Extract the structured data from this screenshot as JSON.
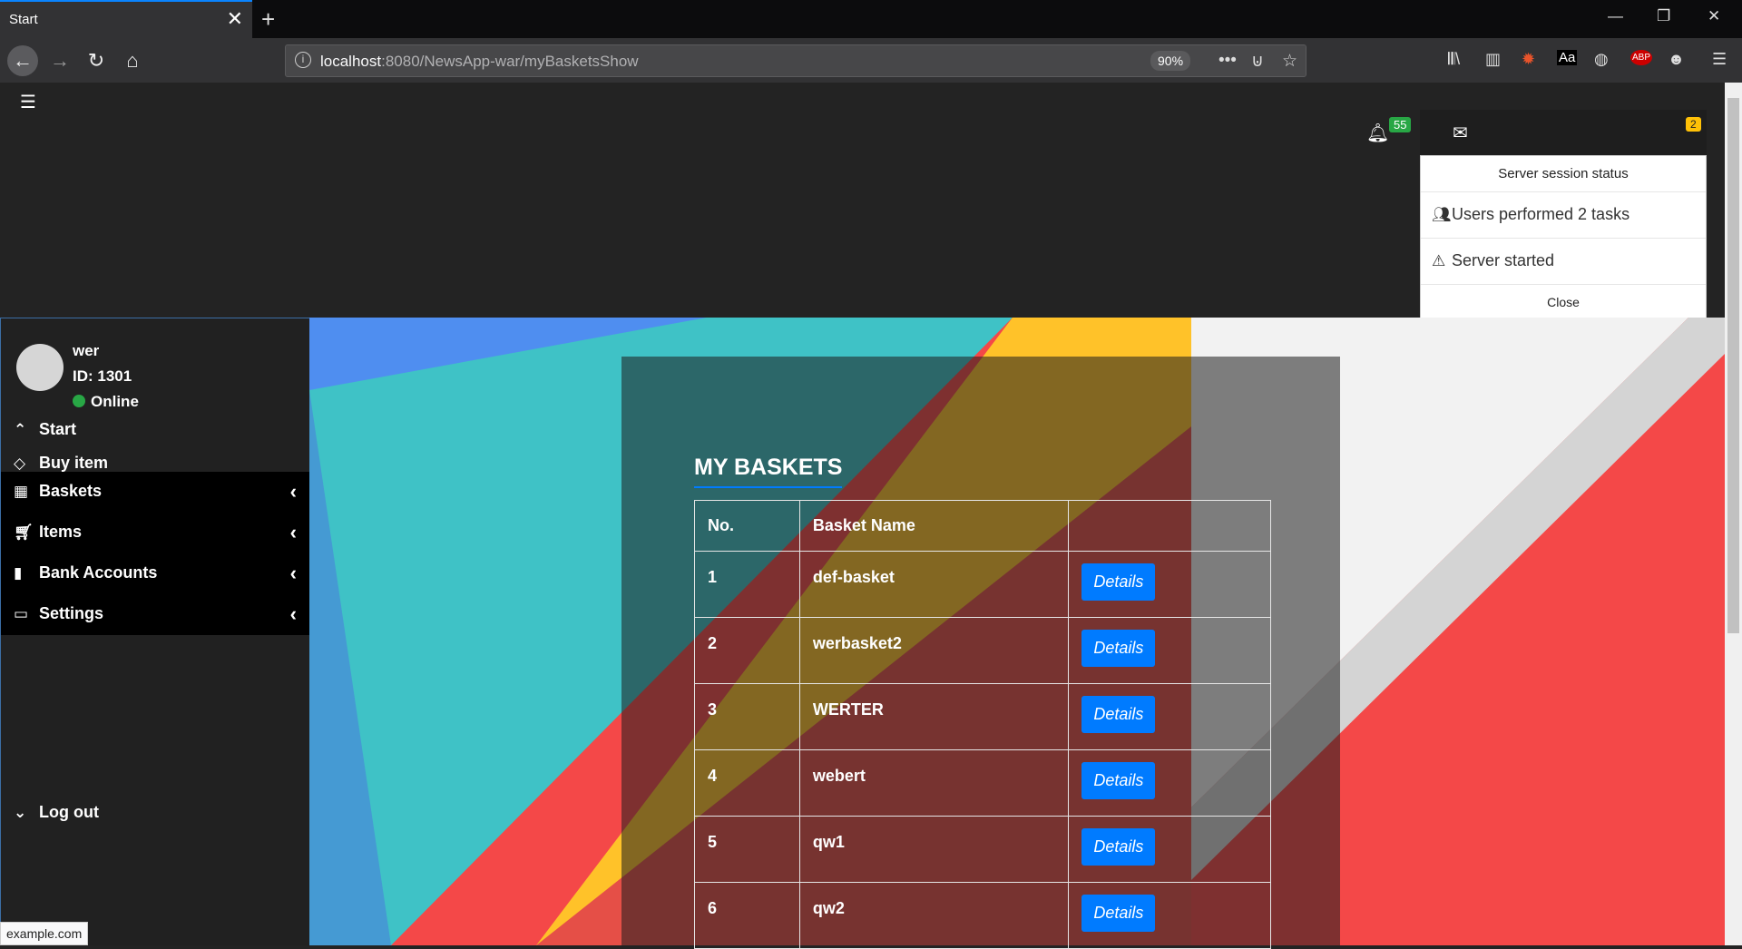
{
  "browser": {
    "tab_title": "Start",
    "tab_close": "✕",
    "new_tab": "+",
    "url_host": "localhost",
    "url_rest": ":8080/NewsApp-war/myBasketsShow",
    "zoom": "90%",
    "status_url": "example.com"
  },
  "header": {
    "notif_count": "55",
    "mail_count": "2"
  },
  "session_dropdown": {
    "title": "Server session status",
    "items": [
      "Users performed 2 tasks",
      "Server started"
    ],
    "close_label": "Close"
  },
  "user": {
    "name": "wer",
    "id": "ID: 1301",
    "status": "Online"
  },
  "sidebar": {
    "items": [
      {
        "label": "Start"
      },
      {
        "label": "Buy item"
      },
      {
        "label": "Baskets"
      },
      {
        "label": "Items"
      },
      {
        "label": "Bank Accounts"
      },
      {
        "label": "Settings"
      },
      {
        "label": "Log out"
      }
    ]
  },
  "main": {
    "title": "MY BASKETS",
    "columns": [
      "No.",
      "Basket Name",
      ""
    ],
    "details_label": "Details",
    "rows": [
      {
        "no": "1",
        "name": "def-basket"
      },
      {
        "no": "2",
        "name": "werbasket2"
      },
      {
        "no": "3",
        "name": "WERTER"
      },
      {
        "no": "4",
        "name": "webert"
      },
      {
        "no": "5",
        "name": "qw1"
      },
      {
        "no": "6",
        "name": "qw2"
      }
    ]
  },
  "colors": {
    "accent": "#007bff",
    "online": "#28a745",
    "notif_badge": "#28a745",
    "mail_badge": "#ffc107"
  }
}
